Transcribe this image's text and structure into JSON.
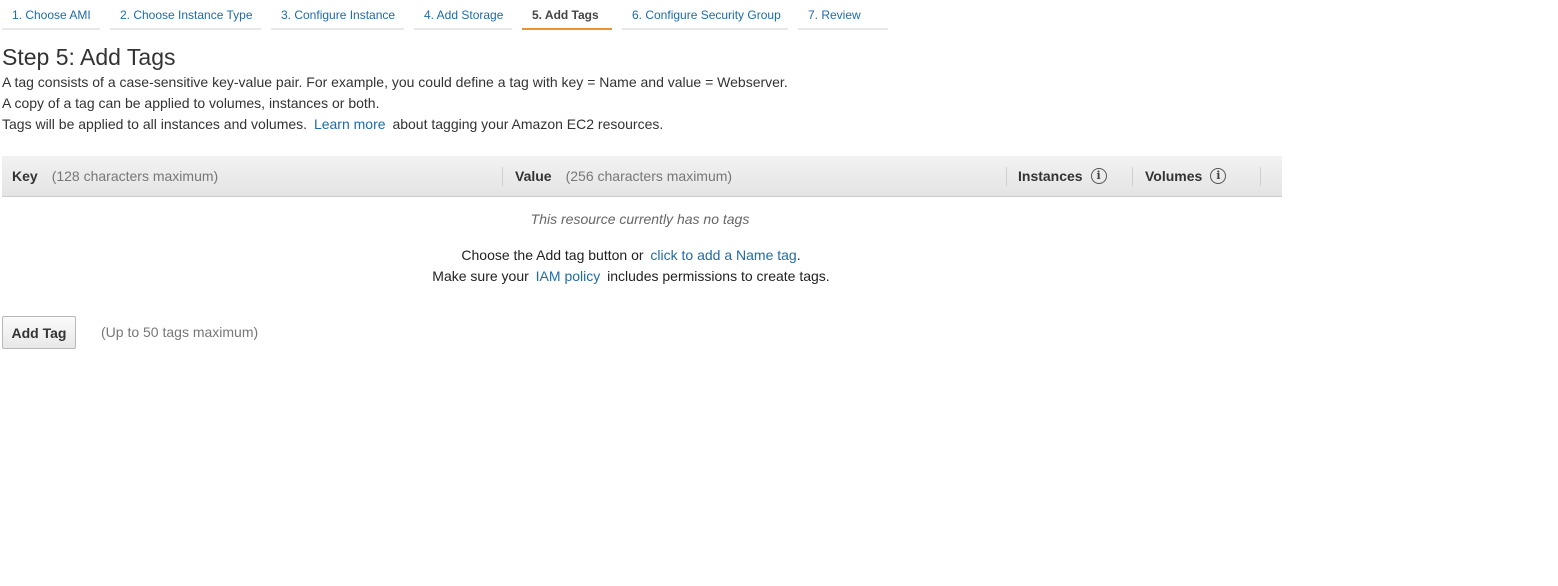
{
  "wizard": {
    "tabs": [
      {
        "label": "1. Choose AMI"
      },
      {
        "label": "2. Choose Instance Type"
      },
      {
        "label": "3. Configure Instance"
      },
      {
        "label": "4. Add Storage"
      },
      {
        "label": "5. Add Tags",
        "active": true
      },
      {
        "label": "6. Configure Security Group"
      },
      {
        "label": "7. Review"
      }
    ]
  },
  "page": {
    "title": "Step 5: Add Tags",
    "desc_line1": "A tag consists of a case-sensitive key-value pair. For example, you could define a tag with key = Name and value = Webserver.",
    "desc_line2": "A copy of a tag can be applied to volumes, instances or both.",
    "desc_line3_prefix": "Tags will be applied to all instances and volumes.",
    "learn_more_link": "Learn more",
    "desc_line3_suffix": "about tagging your Amazon EC2 resources."
  },
  "table": {
    "key_header": "Key",
    "key_hint": "(128 characters maximum)",
    "value_header": "Value",
    "value_hint": "(256 characters maximum)",
    "instances_header": "Instances",
    "volumes_header": "Volumes",
    "empty_message": "This resource currently has no tags",
    "choose_prefix": "Choose the Add tag button or",
    "name_tag_link": "click to add a Name tag",
    "choose_suffix": ".",
    "iam_prefix": "Make sure your",
    "iam_link": "IAM policy",
    "iam_suffix": "includes permissions to create tags."
  },
  "actions": {
    "add_tag_button": "Add Tag",
    "max_note": "(Up to 50 tags maximum)"
  },
  "colors": {
    "link": "#1f6ba6",
    "active_tab_underline": "#ec912f"
  },
  "icons": {
    "info": "info-icon"
  }
}
